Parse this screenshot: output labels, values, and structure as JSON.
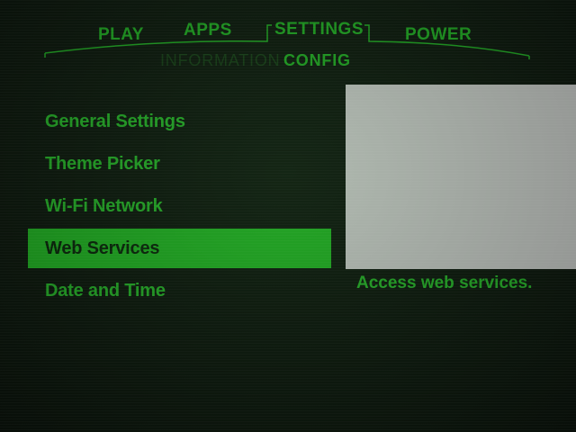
{
  "top_tabs": {
    "play": "PLAY",
    "apps": "APPS",
    "settings": "SETTINGS",
    "power": "POWER"
  },
  "sub_tabs": {
    "information": "INFORMATION",
    "config": "CONFIG"
  },
  "menu": {
    "items": [
      "General Settings",
      "Theme Picker",
      "Wi-Fi Network",
      "Web Services",
      "Date and Time"
    ],
    "selected_index": 3
  },
  "description": "Access web services.",
  "colors": {
    "accent": "#2fe033",
    "background": "#0f1a10",
    "dim": "#1b4a1c"
  }
}
